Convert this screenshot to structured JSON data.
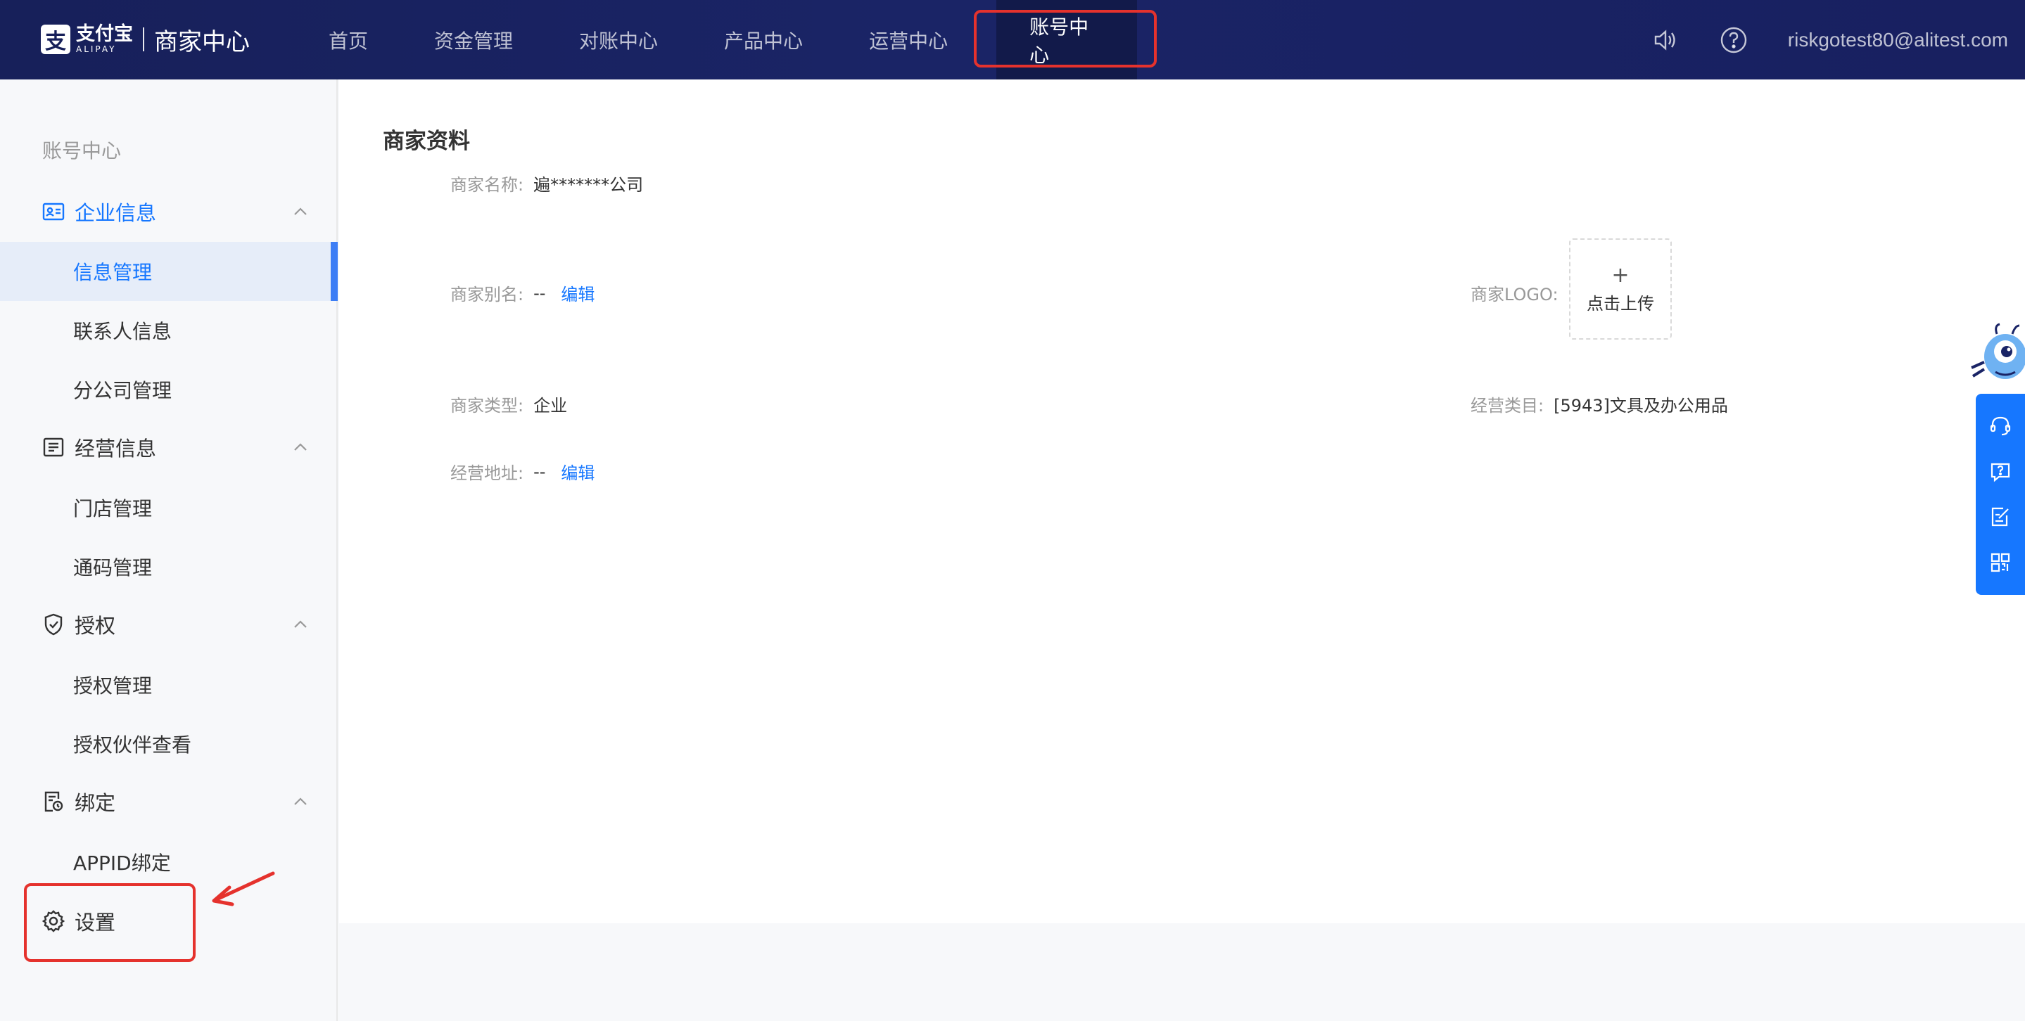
{
  "brand": {
    "mark": "支",
    "logo_cn": "支付宝",
    "logo_en": "ALIPAY",
    "title": "商家中心"
  },
  "nav": {
    "items": [
      "首页",
      "资金管理",
      "对账中心",
      "产品中心",
      "运营中心",
      "账号中心"
    ],
    "active": "账号中心"
  },
  "user": {
    "email": "riskgotest80@alitest.com"
  },
  "sidebar": {
    "title": "账号中心",
    "groups": [
      {
        "label": "企业信息",
        "icon": "id-card-icon",
        "items": [
          "信息管理",
          "联系人信息",
          "分公司管理"
        ]
      },
      {
        "label": "经营信息",
        "icon": "document-list-icon",
        "items": [
          "门店管理",
          "通码管理"
        ]
      },
      {
        "label": "授权",
        "icon": "shield-check-icon",
        "items": [
          "授权管理",
          "授权伙伴查看"
        ]
      },
      {
        "label": "绑定",
        "icon": "bind-doc-icon",
        "items": [
          "APPID绑定"
        ]
      }
    ],
    "active_item": "信息管理",
    "settings": "设置"
  },
  "profile": {
    "section_title": "商家资料",
    "name_label": "商家名称:",
    "name_value": "遍*******公司",
    "alias_label": "商家别名:",
    "alias_value": "--",
    "alias_edit": "编辑",
    "logo_label": "商家LOGO:",
    "logo_upload_plus": "+",
    "logo_upload_text": "点击上传",
    "type_label": "商家类型:",
    "type_value": "企业",
    "category_label": "经营类目:",
    "category_value": "[5943]文具及办公用品",
    "address_label": "经营地址:",
    "address_value": "--",
    "address_edit": "编辑"
  },
  "colors": {
    "header_bg": "#17205a",
    "accent": "#1677ff",
    "highlight_red": "#e5322d"
  }
}
